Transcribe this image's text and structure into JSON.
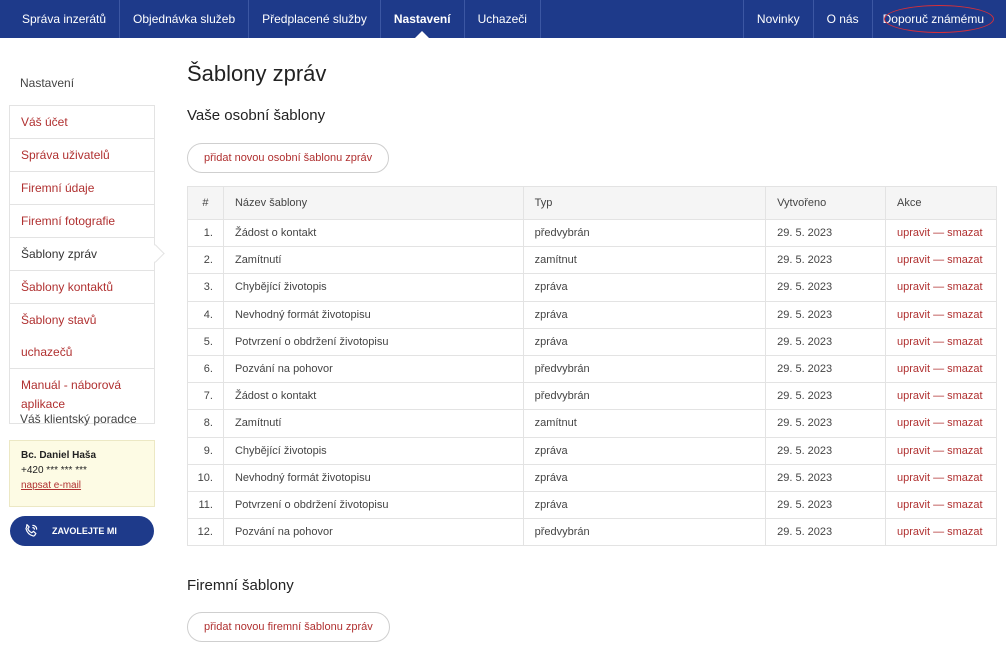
{
  "topnav": {
    "items": [
      {
        "label": "Správa inzerátů"
      },
      {
        "label": "Objednávka služeb"
      },
      {
        "label": "Předplacené služby"
      },
      {
        "label": "Nastavení"
      },
      {
        "label": "Uchazeči"
      }
    ],
    "right_items": [
      {
        "label": "Novinky"
      },
      {
        "label": "O nás"
      },
      {
        "label": "Doporuč známému"
      }
    ]
  },
  "sidebar": {
    "heading": "Nastavení",
    "items": [
      {
        "label": "Váš účet"
      },
      {
        "label": "Správa uživatelů"
      },
      {
        "label": "Firemní údaje"
      },
      {
        "label": "Firemní fotografie"
      },
      {
        "label": "Šablony zpráv"
      },
      {
        "label": "Šablony kontaktů"
      },
      {
        "label": "Šablony stavů uchazečů"
      },
      {
        "label": "Manuál - náborová aplikace"
      }
    ],
    "advisor_heading": "Váš klientský poradce",
    "advisor": {
      "name": "Bc. Daniel Haša",
      "phone": "+420 *** *** ***",
      "email_link": "napsat e-mail"
    },
    "call_button": "ZAVOLEJTE MI"
  },
  "main": {
    "title": "Šablony zpráv",
    "personal_heading": "Vaše osobní šablony",
    "add_personal_button": "přidat novou osobní šablonu zpráv",
    "table": {
      "columns": [
        "#",
        "Název šablony",
        "Typ",
        "Vytvořeno",
        "Akce"
      ],
      "edit_label": "upravit",
      "separator": "—",
      "delete_label": "smazat",
      "rows": [
        {
          "num": "1.",
          "name": "Žádost o kontakt",
          "type": "předvybrán",
          "created": "29. 5. 2023"
        },
        {
          "num": "2.",
          "name": "Zamítnutí",
          "type": "zamítnut",
          "created": "29. 5. 2023"
        },
        {
          "num": "3.",
          "name": "Chybějící životopis",
          "type": "zpráva",
          "created": "29. 5. 2023"
        },
        {
          "num": "4.",
          "name": "Nevhodný formát životopisu",
          "type": "zpráva",
          "created": "29. 5. 2023"
        },
        {
          "num": "5.",
          "name": "Potvrzení o obdržení životopisu",
          "type": "zpráva",
          "created": "29. 5. 2023"
        },
        {
          "num": "6.",
          "name": "Pozvání na pohovor",
          "type": "předvybrán",
          "created": "29. 5. 2023"
        },
        {
          "num": "7.",
          "name": "Žádost o kontakt",
          "type": "předvybrán",
          "created": "29. 5. 2023"
        },
        {
          "num": "8.",
          "name": "Zamítnutí",
          "type": "zamítnut",
          "created": "29. 5. 2023"
        },
        {
          "num": "9.",
          "name": "Chybějící životopis",
          "type": "zpráva",
          "created": "29. 5. 2023"
        },
        {
          "num": "10.",
          "name": "Nevhodný formát životopisu",
          "type": "zpráva",
          "created": "29. 5. 2023"
        },
        {
          "num": "11.",
          "name": "Potvrzení o obdržení životopisu",
          "type": "zpráva",
          "created": "29. 5. 2023"
        },
        {
          "num": "12.",
          "name": "Pozvání na pohovor",
          "type": "předvybrán",
          "created": "29. 5. 2023"
        }
      ]
    },
    "company_heading": "Firemní šablony",
    "add_company_button": "přidat novou firemní šablonu zpráv"
  },
  "colors": {
    "nav_bg": "#1e3a8a",
    "link": "#b03030",
    "highlight_circle": "#d4303a",
    "advisor_bg": "#fdfbe4"
  },
  "icons": {
    "call_button": "phone-icon"
  }
}
